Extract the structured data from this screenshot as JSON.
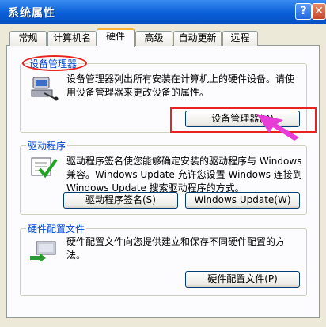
{
  "window": {
    "title": "系统属性",
    "help_label": "?",
    "close_label": "✕"
  },
  "tabs": [
    {
      "label": "常规"
    },
    {
      "label": "计算机名"
    },
    {
      "label": "硬件",
      "active": true
    },
    {
      "label": "高级"
    },
    {
      "label": "自动更新"
    },
    {
      "label": "远程"
    }
  ],
  "device_manager": {
    "title": "设备管理器",
    "description_line1": "设备管理器列出所有安装在计算机上的硬件设备。请使",
    "description_line2": "用设备管理器来更改设备的属性。",
    "button_label": "设备管理器(D)"
  },
  "drivers": {
    "title": "驱动程序",
    "description_line1": "驱动程序签名使您能够确定安装的驱动程序与 Windows",
    "description_line2": "兼容。Windows Update 允许您设置 Windows 连接到",
    "description_line3": "Windows Update 搜索驱动程序的方式。",
    "signing_button_label": "驱动程序签名(S)",
    "update_button_label": "Windows Update(W)"
  },
  "hardware_profiles": {
    "title": "硬件配置文件",
    "description_line1": "硬件配置文件向您提供建立和保存不同硬件配置的方",
    "description_line2": "法。",
    "button_label": "硬件配置文件(P)"
  },
  "annotation": {
    "arrow_color": "#e83cd6",
    "highlight_color": "#e8231f"
  }
}
